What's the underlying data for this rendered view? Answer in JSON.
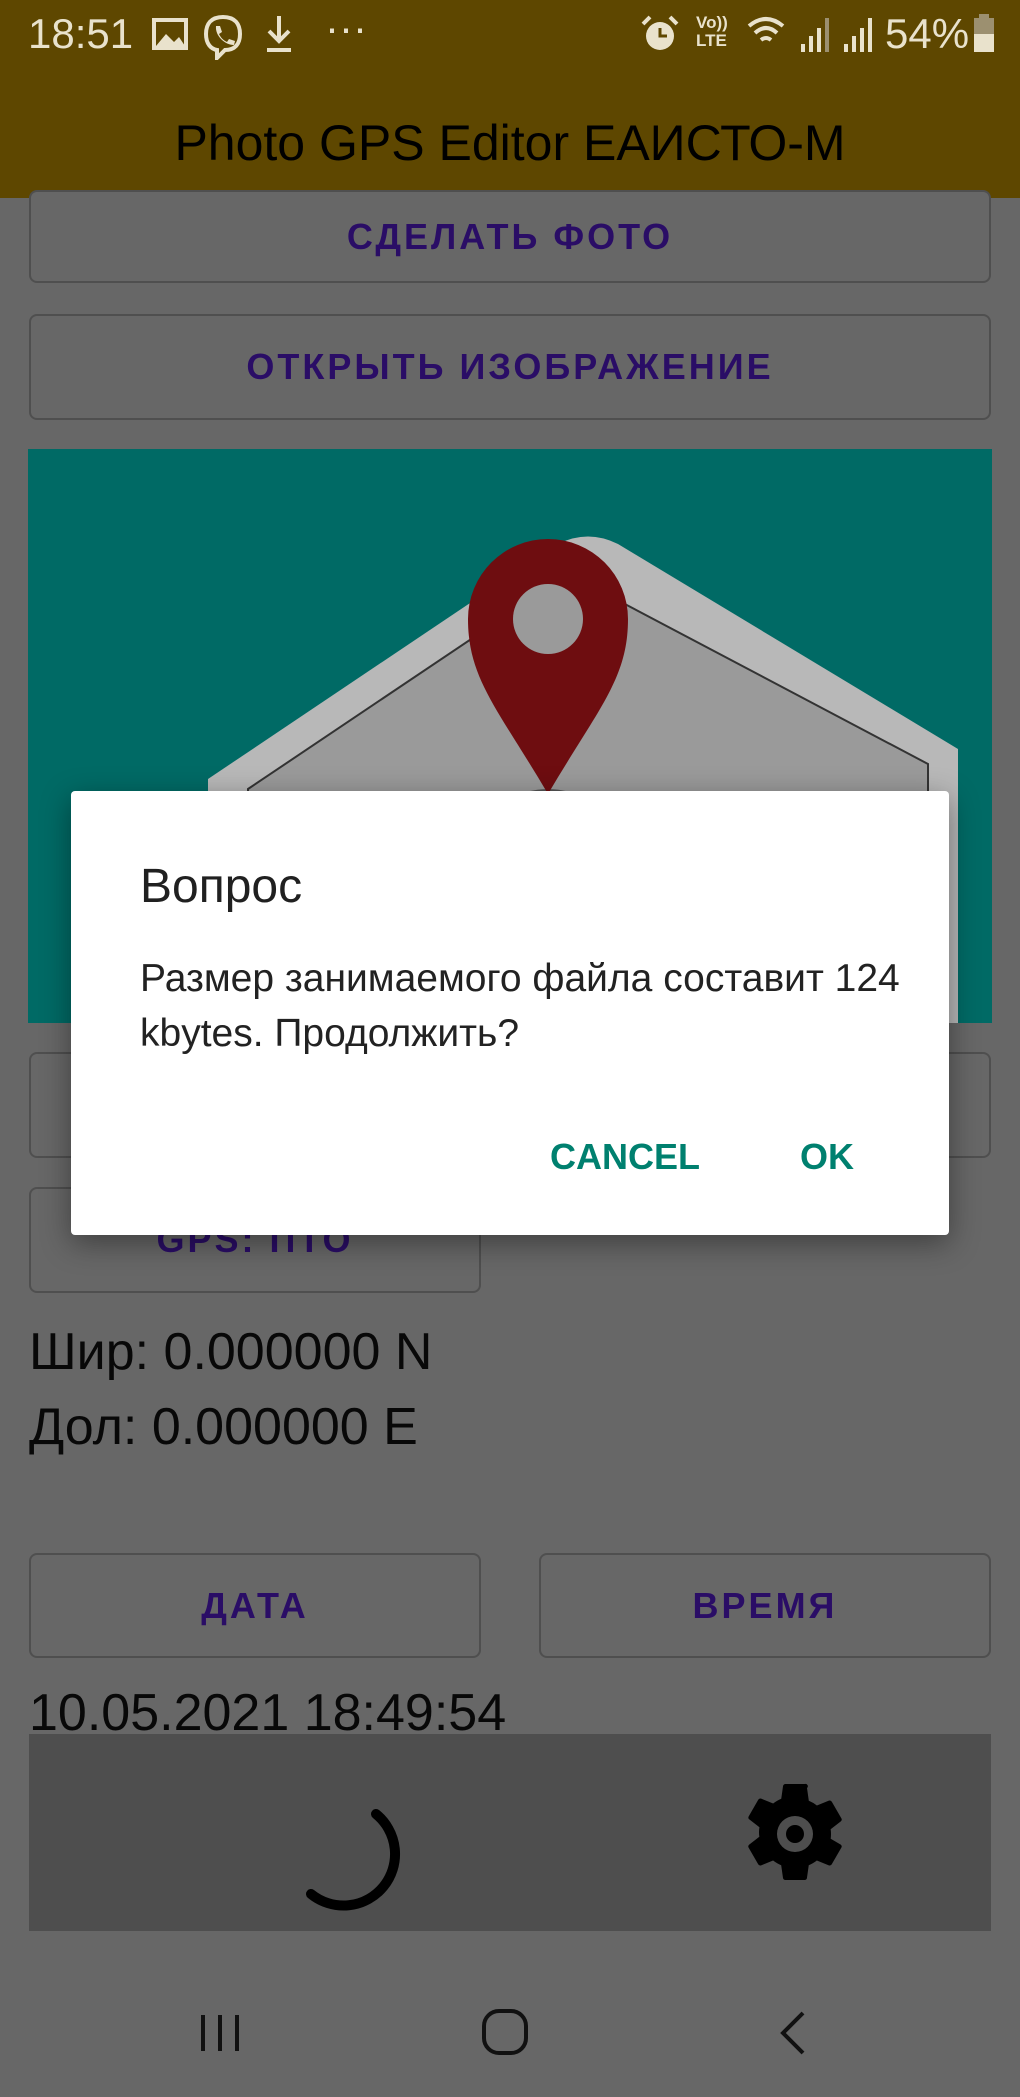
{
  "status_bar": {
    "time": "18:51",
    "battery": "54%",
    "icons": [
      "gallery-icon",
      "viber-icon",
      "download-icon",
      "more-icon",
      "alarm-icon",
      "volte-icon",
      "wifi-icon",
      "signal-icon",
      "signal-icon",
      "battery-icon"
    ],
    "more": "···",
    "volte": "Vo)) LTE"
  },
  "app_bar": {
    "title": "Photo GPS Editor ЕАИСТО-М",
    "color": "#5e4700"
  },
  "main": {
    "take_photo": "СДЕЛАТЬ ФОТО",
    "open_image": "ОТКРЫТЬ ИЗОБРАЖЕНИЕ",
    "gps_button": "GPS: ПТО",
    "latitude": "Шир: 0.000000 N",
    "longitude": "Дол: 0.000000 E",
    "date_button": "ДАТА",
    "time_button": "ВРЕМЯ",
    "datetime": "10.05.2021 18:49:54"
  },
  "dialog": {
    "title": "Вопрос",
    "message": "Размер занимаемого файла составит 124 kbytes. Продолжить?",
    "cancel": "CANCEL",
    "ok": "OK",
    "accent": "#00806f"
  },
  "bottom_bar": {
    "icons": [
      "loading-spinner-icon",
      "gear-icon"
    ]
  },
  "nav_bar": {
    "icons": [
      "recents-icon",
      "home-icon",
      "back-icon"
    ]
  }
}
